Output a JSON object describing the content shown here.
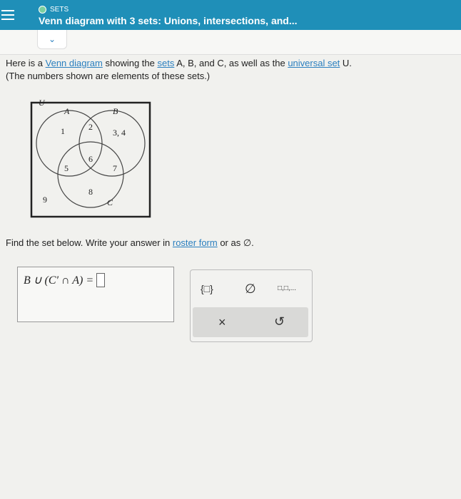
{
  "header": {
    "topic": "SETS",
    "title": "Venn diagram with 3 sets: Unions, intersections, and..."
  },
  "intro": {
    "t1": "Here is a ",
    "venn_link": "Venn diagram",
    "t2": " showing the ",
    "sets_link": "sets",
    "t3": " A, B, and C, as well as the ",
    "universal_link": "universal set",
    "t4": " U.",
    "line2": "(The numbers shown are elements of these sets.)"
  },
  "venn": {
    "labels": {
      "U": "U",
      "A": "A",
      "B": "B",
      "C": "C"
    },
    "elements": {
      "a_only": "1",
      "a_b": "2",
      "b_only": "3, 4",
      "a_c": "5",
      "abc": "6",
      "b_c": "7",
      "c_only": "8",
      "outside": "9"
    }
  },
  "question": {
    "t1": "Find the set below. Write your answer in ",
    "link": "roster form",
    "t2": " or as ∅."
  },
  "expression": "B ∪ (C′ ∩ A) =",
  "tools": {
    "braces": "{□}",
    "empty": "∅",
    "list": "□,□,...",
    "clear": "×",
    "undo": "↺"
  },
  "colors": {
    "header": "#1f8fb8",
    "link": "#2a7fbf"
  }
}
